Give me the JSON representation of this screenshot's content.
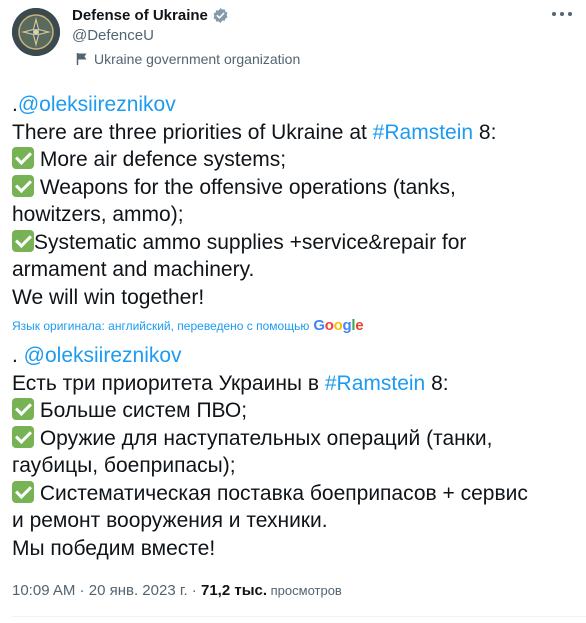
{
  "author": {
    "name": "Defense of Ukraine",
    "handle": "@DefenceU",
    "label": "Ukraine government organization"
  },
  "original": {
    "mention_prefix": ".",
    "mention": "@oleksiireznikov",
    "line2_pre": "There are three priorities of Ukraine at ",
    "hashtag": "#Ramstein",
    "line2_post": " 8:",
    "item1": " More air defence systems;",
    "item2a": " Weapons for the offensive operations (tanks,",
    "item2b": "howitzers, ammo);",
    "item3a": "Systematic ammo supplies +service&repair for",
    "item3b": "armament and machinery.",
    "closing": "We will win together!"
  },
  "translation_note": {
    "text": "Язык оригинала: английский, переведено с помощью",
    "provider": "Google"
  },
  "translated": {
    "mention_prefix": ". ",
    "mention": "@oleksiireznikov",
    "line2_pre": "Есть три приоритета Украины в ",
    "hashtag": "#Ramstein",
    "line2_post": " 8:",
    "item1": " Больше систем ПВО;",
    "item2a": " Оружие для наступательных операций (танки,",
    "item2b": "гаубицы, боеприпасы);",
    "item3a": " Систематическая поставка боеприпасов + сервис",
    "item3b": "и ремонт вооружения и техники.",
    "closing": "Мы победим вместе!"
  },
  "meta": {
    "time": "10:09 AM",
    "dot1": " · ",
    "date": "20 янв. 2023 г.",
    "dot2": " · ",
    "views": "71,2 тыс.",
    "views_label": " просмотров"
  },
  "icons": {
    "verified": "verified-badge-icon",
    "flag": "government-flag-icon",
    "more": "more-options-icon",
    "check": "check-mark-emoji-icon"
  },
  "colors": {
    "link": "#1d9bf0",
    "text": "#0f1419",
    "secondary": "#536471",
    "check": "#77b255"
  }
}
